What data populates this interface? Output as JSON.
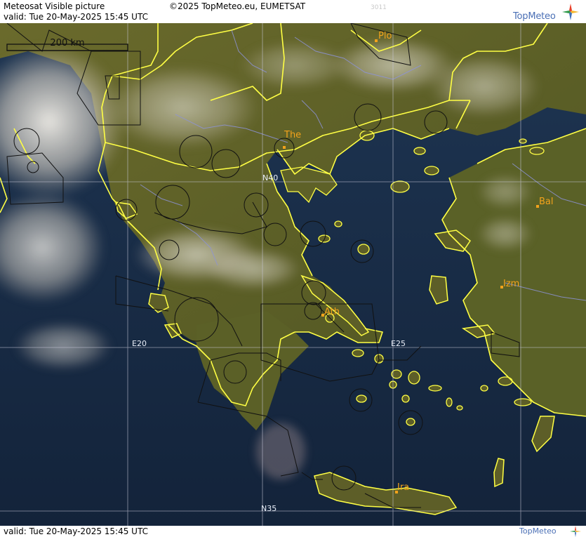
{
  "header": {
    "title": "Meteosat Visible picture",
    "valid_line": "valid:  Tue  20-May-2025  15:45 UTC",
    "copyright": "©2025 TopMeteo.eu, EUMETSAT",
    "code": "3011"
  },
  "footer": {
    "valid_line": "valid:  Tue  20-May-2025  15:45 UTC"
  },
  "logo": {
    "text": "TopMeteo",
    "colors": [
      "#e8402a",
      "#f5b82e",
      "#3f6fb8",
      "#2f9a4a"
    ]
  },
  "scale_bar": {
    "label": "200 km"
  },
  "grid": {
    "lat_labels": [
      "N40",
      "N35"
    ],
    "lon_labels": [
      "E20",
      "E25"
    ]
  },
  "cities": [
    {
      "name": "Plo"
    },
    {
      "name": "The"
    },
    {
      "name": "Bal"
    },
    {
      "name": "Izm"
    },
    {
      "name": "Ath"
    },
    {
      "name": "Ira"
    }
  ],
  "colors": {
    "sea": "#1a2d48",
    "land": "#5d5e26",
    "border": "#ffff44",
    "city_label": "#f2a21b"
  }
}
